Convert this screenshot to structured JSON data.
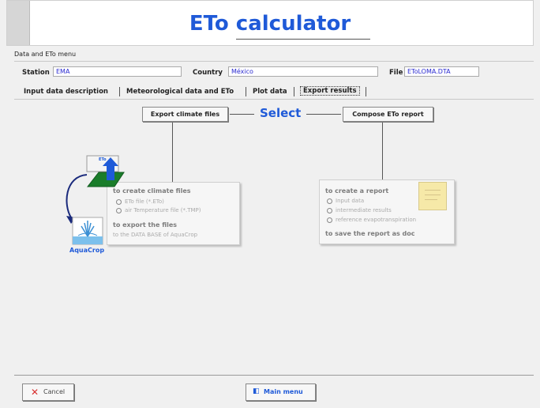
{
  "app": {
    "title": "ETo calculator"
  },
  "menu": {
    "label": "Data and ETo menu"
  },
  "fields": {
    "station_label": "Station",
    "station_value": "EMA",
    "country_label": "Country",
    "country_value": "México",
    "file_label": "File",
    "file_value": "EToLOMA.DTA"
  },
  "tabs": [
    {
      "label": "Input data description",
      "active": false
    },
    {
      "label": "Meteorological data and ETo",
      "active": false
    },
    {
      "label": "Plot data",
      "active": false
    },
    {
      "label": "Export results",
      "active": true
    }
  ],
  "export": {
    "climate_button": "Export climate files",
    "select_label": "Select",
    "report_button": "Compose ETo report"
  },
  "climate_panel": {
    "eto_icon_label": "ETo",
    "aquacrop_label": "AquaCrop",
    "heading": "to create climate files",
    "items": [
      "ETo file (*.ETo)",
      "air Temperature file (*.TMP)"
    ],
    "export_heading": "to export the files",
    "export_detail": "to the DATA BASE of AquaCrop"
  },
  "report_panel": {
    "heading": "to create a report",
    "items": [
      "Input data",
      "intermediate results",
      "reference evapotranspiration"
    ],
    "save_label": "to save the report as doc"
  },
  "footer": {
    "cancel_label": "Cancel",
    "main_menu_label": "Main menu"
  },
  "colors": {
    "accent": "#1f5ad8",
    "cancel_icon": "#d83030",
    "eto_green": "#1a7d2a",
    "eto_blue": "#1e5ad8",
    "note_yellow": "#f6e9a8"
  }
}
